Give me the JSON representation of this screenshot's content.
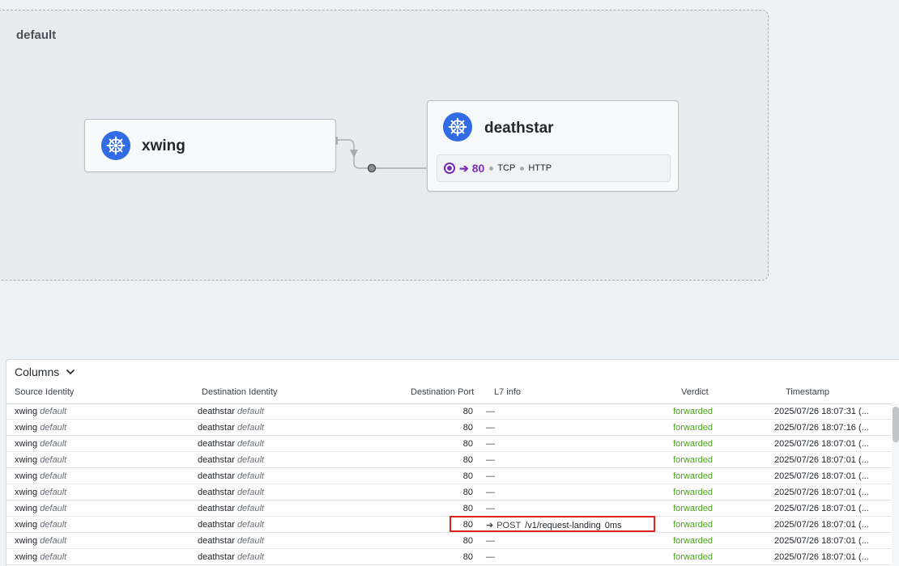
{
  "map": {
    "namespace": "default",
    "nodes": {
      "source": {
        "name": "xwing",
        "icon": "kubernetes-icon"
      },
      "destination": {
        "name": "deathstar",
        "icon": "kubernetes-icon",
        "port": {
          "arrow": "➔",
          "number": "80",
          "protocols": [
            "TCP",
            "HTTP"
          ]
        }
      }
    }
  },
  "flows": {
    "columns_button": "Columns",
    "headers": {
      "source": "Source Identity",
      "destination": "Destination Identity",
      "port": "Destination Port",
      "l7": "L7 info",
      "verdict": "Verdict",
      "timestamp": "Timestamp"
    },
    "rows": [
      {
        "src": "xwing",
        "src_ns": "default",
        "dst": "deathstar",
        "dst_ns": "default",
        "port": "80",
        "l7": "—",
        "verdict": "forwarded",
        "ts": "2025/07/26 18:07:31 (..."
      },
      {
        "src": "xwing",
        "src_ns": "default",
        "dst": "deathstar",
        "dst_ns": "default",
        "port": "80",
        "l7": "—",
        "verdict": "forwarded",
        "ts": "2025/07/26 18:07:16 (..."
      },
      {
        "src": "xwing",
        "src_ns": "default",
        "dst": "deathstar",
        "dst_ns": "default",
        "port": "80",
        "l7": "—",
        "verdict": "forwarded",
        "ts": "2025/07/26 18:07:01 (..."
      },
      {
        "src": "xwing",
        "src_ns": "default",
        "dst": "deathstar",
        "dst_ns": "default",
        "port": "80",
        "l7": "—",
        "verdict": "forwarded",
        "ts": "2025/07/26 18:07:01 (..."
      },
      {
        "src": "xwing",
        "src_ns": "default",
        "dst": "deathstar",
        "dst_ns": "default",
        "port": "80",
        "l7": "—",
        "verdict": "forwarded",
        "ts": "2025/07/26 18:07:01 (..."
      },
      {
        "src": "xwing",
        "src_ns": "default",
        "dst": "deathstar",
        "dst_ns": "default",
        "port": "80",
        "l7": "—",
        "verdict": "forwarded",
        "ts": "2025/07/26 18:07:01 (..."
      },
      {
        "src": "xwing",
        "src_ns": "default",
        "dst": "deathstar",
        "dst_ns": "default",
        "port": "80",
        "l7": "—",
        "verdict": "forwarded",
        "ts": "2025/07/26 18:07:01 (..."
      },
      {
        "src": "xwing",
        "src_ns": "default",
        "dst": "deathstar",
        "dst_ns": "default",
        "port": "80",
        "l7": "",
        "l7_http": {
          "arrow": "➔",
          "method": "POST",
          "url": "/v1/request-landing",
          "latency": "0ms"
        },
        "verdict": "forwarded",
        "ts": "2025/07/26 18:07:01 (..."
      },
      {
        "src": "xwing",
        "src_ns": "default",
        "dst": "deathstar",
        "dst_ns": "default",
        "port": "80",
        "l7": "—",
        "verdict": "forwarded",
        "ts": "2025/07/26 18:07:01 (..."
      },
      {
        "src": "xwing",
        "src_ns": "default",
        "dst": "deathstar",
        "dst_ns": "default",
        "port": "80",
        "l7": "—",
        "verdict": "forwarded",
        "ts": "2025/07/26 18:07:01 (..."
      }
    ]
  },
  "colors": {
    "accent_purple": "#7a2fb5",
    "verdict_forwarded": "#4aa222",
    "highlight": "#e0251f",
    "kubernetes_blue": "#326ce5"
  }
}
